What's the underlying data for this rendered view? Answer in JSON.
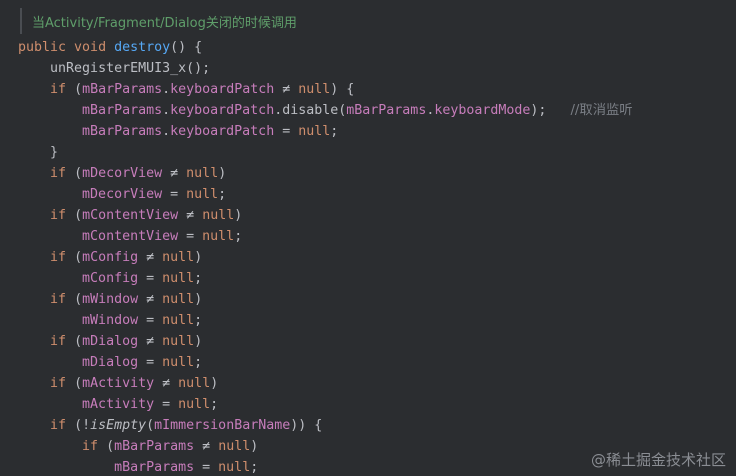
{
  "doc_comment": "当Activity/Fragment/Dialog关闭的时候调用",
  "watermark": "@稀土掘金技术社区",
  "colors": {
    "background": "#2b2d30",
    "keyword": "#cf8e6d",
    "function": "#56a8f5",
    "field": "#c77dbb",
    "text": "#bcbec4",
    "comment": "#7a7e85",
    "doc_comment": "#5f9e6a"
  },
  "code_lines": [
    {
      "indent": "",
      "tokens": [
        [
          "kw",
          "public "
        ],
        [
          "kw",
          "void "
        ],
        [
          "fn",
          "destroy"
        ],
        [
          "plain",
          "() {"
        ]
      ]
    },
    {
      "indent": "    ",
      "tokens": [
        [
          "plain",
          "unRegisterEMUI3_x();"
        ]
      ]
    },
    {
      "indent": "    ",
      "tokens": [
        [
          "kw",
          "if "
        ],
        [
          "plain",
          "("
        ],
        [
          "fld",
          "mBarParams"
        ],
        [
          "plain",
          "."
        ],
        [
          "fld",
          "keyboardPatch"
        ],
        [
          "plain",
          " ≠ "
        ],
        [
          "kw",
          "null"
        ],
        [
          "plain",
          ") {"
        ]
      ]
    },
    {
      "indent": "        ",
      "tokens": [
        [
          "fld",
          "mBarParams"
        ],
        [
          "plain",
          "."
        ],
        [
          "fld",
          "keyboardPatch"
        ],
        [
          "plain",
          ".disable("
        ],
        [
          "fld",
          "mBarParams"
        ],
        [
          "plain",
          "."
        ],
        [
          "fld",
          "keyboardMode"
        ],
        [
          "plain",
          ");   "
        ],
        [
          "cm",
          "//取消监听"
        ]
      ]
    },
    {
      "indent": "        ",
      "tokens": [
        [
          "fld",
          "mBarParams"
        ],
        [
          "plain",
          "."
        ],
        [
          "fld",
          "keyboardPatch"
        ],
        [
          "plain",
          " = "
        ],
        [
          "kw",
          "null"
        ],
        [
          "plain",
          ";"
        ]
      ]
    },
    {
      "indent": "    ",
      "tokens": [
        [
          "plain",
          "}"
        ]
      ]
    },
    {
      "indent": "    ",
      "tokens": [
        [
          "kw",
          "if "
        ],
        [
          "plain",
          "("
        ],
        [
          "fld",
          "mDecorView"
        ],
        [
          "plain",
          " ≠ "
        ],
        [
          "kw",
          "null"
        ],
        [
          "plain",
          ")"
        ]
      ]
    },
    {
      "indent": "        ",
      "tokens": [
        [
          "fld",
          "mDecorView"
        ],
        [
          "plain",
          " = "
        ],
        [
          "kw",
          "null"
        ],
        [
          "plain",
          ";"
        ]
      ]
    },
    {
      "indent": "    ",
      "tokens": [
        [
          "kw",
          "if "
        ],
        [
          "plain",
          "("
        ],
        [
          "fld",
          "mContentView"
        ],
        [
          "plain",
          " ≠ "
        ],
        [
          "kw",
          "null"
        ],
        [
          "plain",
          ")"
        ]
      ]
    },
    {
      "indent": "        ",
      "current": true,
      "tokens": [
        [
          "fld",
          "mContentView"
        ],
        [
          "plain",
          " = "
        ],
        [
          "kw",
          "null"
        ],
        [
          "plain",
          ";"
        ]
      ]
    },
    {
      "indent": "    ",
      "tokens": [
        [
          "kw",
          "if "
        ],
        [
          "plain",
          "("
        ],
        [
          "fld",
          "mConfig"
        ],
        [
          "plain",
          " ≠ "
        ],
        [
          "kw",
          "null"
        ],
        [
          "plain",
          ")"
        ]
      ]
    },
    {
      "indent": "        ",
      "tokens": [
        [
          "fld",
          "mConfig"
        ],
        [
          "plain",
          " = "
        ],
        [
          "kw",
          "null"
        ],
        [
          "plain",
          ";"
        ]
      ]
    },
    {
      "indent": "    ",
      "tokens": [
        [
          "kw",
          "if "
        ],
        [
          "plain",
          "("
        ],
        [
          "fld",
          "mWindow"
        ],
        [
          "plain",
          " ≠ "
        ],
        [
          "kw",
          "null"
        ],
        [
          "plain",
          ")"
        ]
      ]
    },
    {
      "indent": "        ",
      "tokens": [
        [
          "fld",
          "mWindow"
        ],
        [
          "plain",
          " = "
        ],
        [
          "kw",
          "null"
        ],
        [
          "plain",
          ";"
        ]
      ]
    },
    {
      "indent": "    ",
      "tokens": [
        [
          "kw",
          "if "
        ],
        [
          "plain",
          "("
        ],
        [
          "fld",
          "mDialog"
        ],
        [
          "plain",
          " ≠ "
        ],
        [
          "kw",
          "null"
        ],
        [
          "plain",
          ")"
        ]
      ]
    },
    {
      "indent": "        ",
      "tokens": [
        [
          "fld",
          "mDialog"
        ],
        [
          "plain",
          " = "
        ],
        [
          "kw",
          "null"
        ],
        [
          "plain",
          ";"
        ]
      ]
    },
    {
      "indent": "    ",
      "tokens": [
        [
          "kw",
          "if "
        ],
        [
          "plain",
          "("
        ],
        [
          "fld",
          "mActivity"
        ],
        [
          "plain",
          " ≠ "
        ],
        [
          "kw",
          "null"
        ],
        [
          "plain",
          ")"
        ]
      ]
    },
    {
      "indent": "        ",
      "tokens": [
        [
          "fld",
          "mActivity"
        ],
        [
          "plain",
          " = "
        ],
        [
          "kw",
          "null"
        ],
        [
          "plain",
          ";"
        ]
      ]
    },
    {
      "indent": "    ",
      "tokens": [
        [
          "kw",
          "if "
        ],
        [
          "plain",
          "(!"
        ],
        [
          "italic",
          "isEmpty"
        ],
        [
          "plain",
          "("
        ],
        [
          "fld",
          "mImmersionBarName"
        ],
        [
          "plain",
          ")) {"
        ]
      ]
    },
    {
      "indent": "        ",
      "tokens": [
        [
          "kw",
          "if "
        ],
        [
          "plain",
          "("
        ],
        [
          "fld",
          "mBarParams"
        ],
        [
          "plain",
          " ≠ "
        ],
        [
          "kw",
          "null"
        ],
        [
          "plain",
          ")"
        ]
      ]
    },
    {
      "indent": "            ",
      "tokens": [
        [
          "fld",
          "mBarParams"
        ],
        [
          "plain",
          " = "
        ],
        [
          "kw",
          "null"
        ],
        [
          "plain",
          ";"
        ]
      ]
    }
  ]
}
